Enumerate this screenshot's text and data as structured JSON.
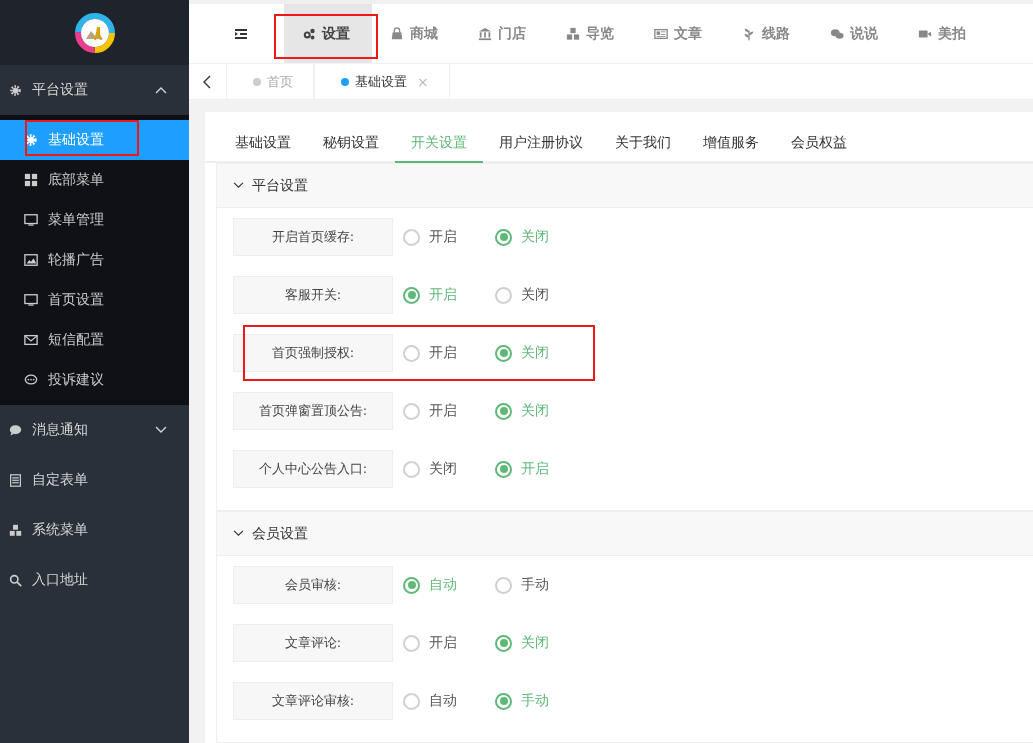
{
  "sidebar": {
    "groups": [
      {
        "label": "平台设置",
        "expanded": true,
        "children": [
          {
            "label": "基础设置",
            "selected": true,
            "highlighted": true
          },
          {
            "label": "底部菜单",
            "selected": false,
            "highlighted": false
          },
          {
            "label": "菜单管理",
            "selected": false,
            "highlighted": false
          },
          {
            "label": "轮播广告",
            "selected": false,
            "highlighted": false
          },
          {
            "label": "首页设置",
            "selected": false,
            "highlighted": false
          },
          {
            "label": "短信配置",
            "selected": false,
            "highlighted": false
          },
          {
            "label": "投诉建议",
            "selected": false,
            "highlighted": false
          }
        ]
      },
      {
        "label": "消息通知",
        "expanded": false
      },
      {
        "label": "自定表单"
      },
      {
        "label": "系统菜单"
      },
      {
        "label": "入口地址"
      }
    ]
  },
  "top_nav": {
    "items": [
      {
        "label": "设置",
        "selected": true,
        "highlighted": true
      },
      {
        "label": "商城",
        "selected": false,
        "highlighted": false
      },
      {
        "label": "门店",
        "selected": false,
        "highlighted": false
      },
      {
        "label": "导览",
        "selected": false,
        "highlighted": false
      },
      {
        "label": "文章",
        "selected": false,
        "highlighted": false
      },
      {
        "label": "线路",
        "selected": false,
        "highlighted": false
      },
      {
        "label": "说说",
        "selected": false,
        "highlighted": false
      },
      {
        "label": "美拍",
        "selected": false,
        "highlighted": false
      }
    ]
  },
  "page_tabs": [
    {
      "label": "首页",
      "selected": false
    },
    {
      "label": "基础设置",
      "selected": true,
      "close": "×"
    }
  ],
  "card_tabs": [
    {
      "label": "基础设置",
      "selected": false
    },
    {
      "label": "秘钥设置",
      "selected": false
    },
    {
      "label": "开关设置",
      "selected": true
    },
    {
      "label": "用户注册协议",
      "selected": false
    },
    {
      "label": "关于我们",
      "selected": false
    },
    {
      "label": "增值服务",
      "selected": false
    },
    {
      "label": "会员权益",
      "selected": false
    }
  ],
  "sections": [
    {
      "title": "平台设置",
      "expanded": true,
      "rows": [
        {
          "label": "开启首页缓存:",
          "highlighted": false,
          "options": [
            {
              "label": "开启",
              "selected": false
            },
            {
              "label": "关闭",
              "selected": true
            }
          ]
        },
        {
          "label": "客服开关:",
          "highlighted": false,
          "options": [
            {
              "label": "开启",
              "selected": true
            },
            {
              "label": "关闭",
              "selected": false
            }
          ]
        },
        {
          "label": "首页强制授权:",
          "highlighted": true,
          "options": [
            {
              "label": "开启",
              "selected": false
            },
            {
              "label": "关闭",
              "selected": true
            }
          ]
        },
        {
          "label": "首页弹窗置顶公告:",
          "highlighted": false,
          "options": [
            {
              "label": "开启",
              "selected": false
            },
            {
              "label": "关闭",
              "selected": true
            }
          ]
        },
        {
          "label": "个人中心公告入口:",
          "highlighted": false,
          "options": [
            {
              "label": "关闭",
              "selected": false
            },
            {
              "label": "开启",
              "selected": true
            }
          ]
        }
      ]
    },
    {
      "title": "会员设置",
      "expanded": true,
      "rows": [
        {
          "label": "会员审核:",
          "highlighted": false,
          "options": [
            {
              "label": "自动",
              "selected": true
            },
            {
              "label": "手动",
              "selected": false
            }
          ]
        },
        {
          "label": "文章评论:",
          "highlighted": false,
          "options": [
            {
              "label": "开启",
              "selected": false
            },
            {
              "label": "关闭",
              "selected": true
            }
          ]
        },
        {
          "label": "文章评论审核:",
          "highlighted": false,
          "options": [
            {
              "label": "自动",
              "selected": false
            },
            {
              "label": "手动",
              "selected": true
            }
          ]
        }
      ]
    }
  ]
}
